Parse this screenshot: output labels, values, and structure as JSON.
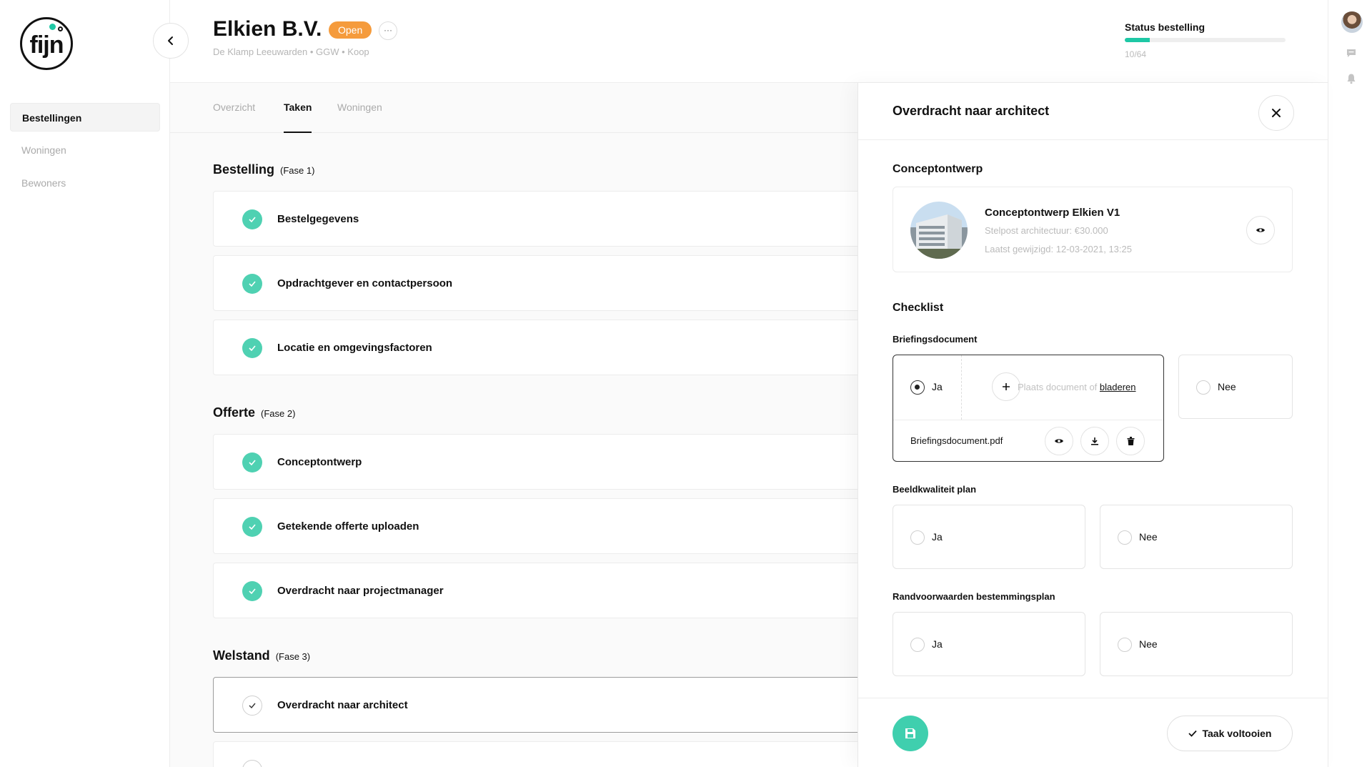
{
  "brand": {
    "logo_text": "fijn"
  },
  "sidebar": {
    "items": [
      {
        "label": "Bestellingen",
        "active": true
      },
      {
        "label": "Woningen",
        "active": false
      },
      {
        "label": "Bewoners",
        "active": false
      }
    ]
  },
  "header": {
    "title": "Elkien B.V.",
    "status_badge": "Open",
    "more_label": "···",
    "subtitle": "De Klamp Leeuwarden • GGW • Koop",
    "status_label": "Status bestelling",
    "status_count": "10/64",
    "progress_fraction": 0.156
  },
  "tabs": [
    {
      "label": "Overzicht",
      "active": false
    },
    {
      "label": "Taken",
      "active": true
    },
    {
      "label": "Woningen",
      "active": false
    }
  ],
  "phases": [
    {
      "name": "Bestelling",
      "phase": "(Fase 1)",
      "tasks": [
        "Bestelgegevens",
        "Opdrachtgever en contactpersoon",
        "Locatie en omgevingsfactoren"
      ]
    },
    {
      "name": "Offerte",
      "phase": "(Fase 2)",
      "tasks": [
        "Conceptontwerp",
        "Getekende offerte uploaden",
        "Overdracht naar projectmanager"
      ]
    },
    {
      "name": "Welstand",
      "phase": "(Fase 3)",
      "tasks": [
        "Overdracht naar architect"
      ]
    }
  ],
  "drawer": {
    "title": "Overdracht naar architect",
    "concept_section": "Conceptontwerp",
    "concept_card": {
      "title": "Conceptontwerp Elkien V1",
      "meta1": "Stelpost architectuur: €30.000",
      "meta2": "Laatst gewijzigd: 12-03-2021, 13:25"
    },
    "checklist_title": "Checklist",
    "briefing": {
      "title": "Briefingsdocument",
      "yes": "Ja",
      "no": "Nee",
      "drop_text": "Plaats document of ",
      "browse": "bladeren",
      "file": "Briefingsdocument.pdf"
    },
    "beeld": {
      "title": "Beeldkwaliteit plan",
      "yes": "Ja",
      "no": "Nee"
    },
    "rand": {
      "title": "Randvoorwaarden bestemmingsplan",
      "yes": "Ja",
      "no": "Nee"
    },
    "complete_label": "Taak voltooien"
  },
  "colors": {
    "accent": "#3fcfae",
    "badge": "#f59b3c"
  },
  "icons": [
    "back-chevron-icon",
    "close-icon",
    "eye-icon",
    "download-icon",
    "trash-icon",
    "plus-icon",
    "save-icon",
    "check-icon",
    "message-icon",
    "bell-icon"
  ]
}
